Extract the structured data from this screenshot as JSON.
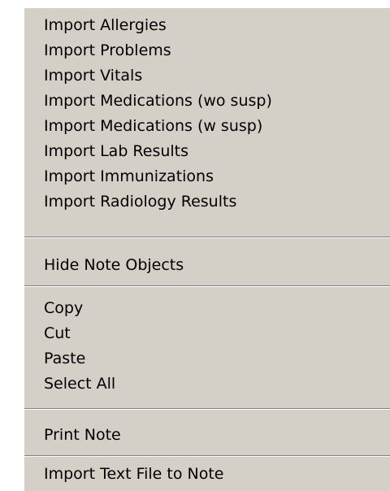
{
  "menu": {
    "import_items": [
      {
        "label": "Import Allergies"
      },
      {
        "label": "Import Problems"
      },
      {
        "label": "Import Vitals"
      },
      {
        "label": "Import Medications (wo susp)"
      },
      {
        "label": "Import Medications (w susp)"
      },
      {
        "label": "Import Lab Results"
      },
      {
        "label": "Import Immunizations"
      },
      {
        "label": "Import Radiology Results"
      }
    ],
    "hide_note_objects": "Hide Note Objects",
    "edit_items": [
      {
        "label": "Copy"
      },
      {
        "label": "Cut"
      },
      {
        "label": "Paste"
      },
      {
        "label": "Select All"
      }
    ],
    "print_note": "Print Note",
    "import_text_file": "Import Text File to Note"
  },
  "colors": {
    "menu_background": "#d4d0c8",
    "separator_dark": "#808080",
    "separator_light": "#ffffff",
    "text": "#000000"
  }
}
